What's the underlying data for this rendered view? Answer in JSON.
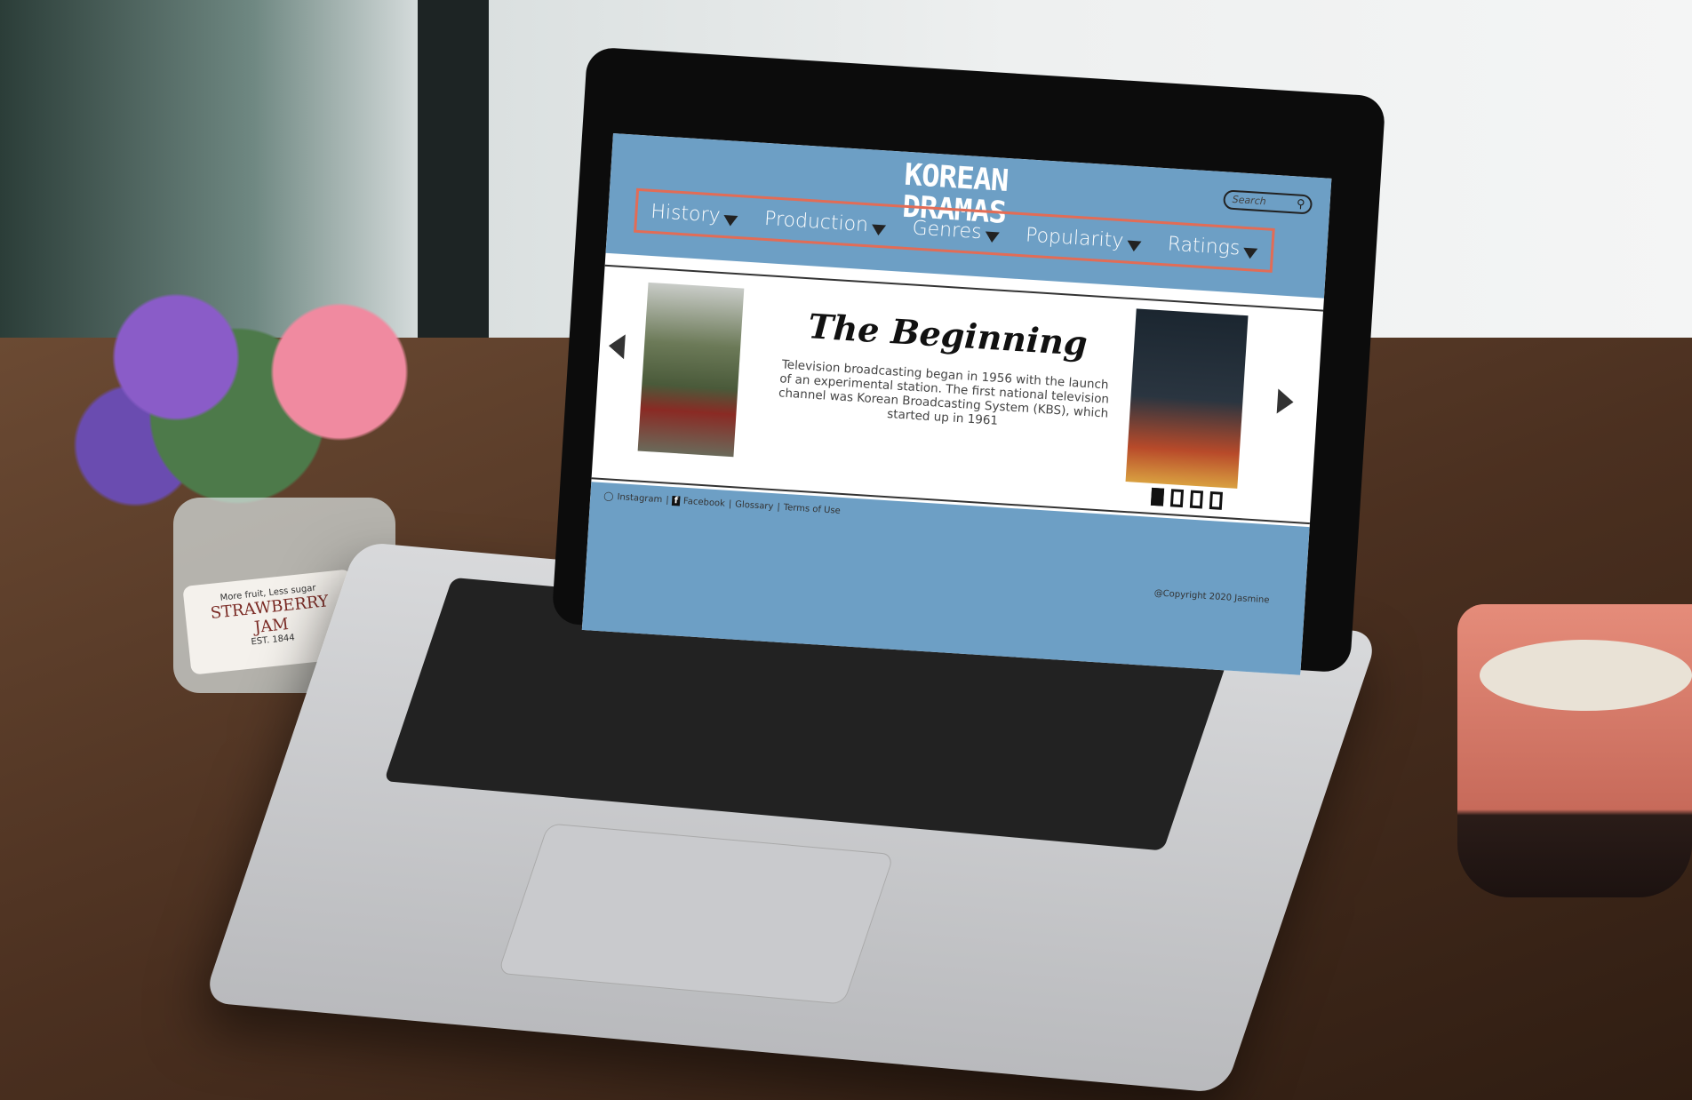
{
  "site": {
    "logo_line1": "KOREAN",
    "logo_line2": "DRAMAS",
    "search_placeholder": "Search",
    "nav": [
      {
        "label": "History"
      },
      {
        "label": "Production"
      },
      {
        "label": "Genres"
      },
      {
        "label": "Popularity"
      },
      {
        "label": "Ratings"
      }
    ],
    "hero": {
      "title": "The Beginning",
      "body": "Television broadcasting began in 1956 with the launch of an experimental station. The first national television channel was Korean Broadcasting System (KBS), which started up in 1961",
      "slides_total": 4,
      "active_slide": 1
    },
    "footer": {
      "links": [
        {
          "label": "Instagram"
        },
        {
          "label": "Facebook"
        },
        {
          "label": "Glossary"
        },
        {
          "label": "Terms of Use"
        }
      ],
      "separator": "|",
      "copyright": "@Copyright 2020 Jasmine"
    },
    "colors": {
      "header": "#6d9fc5",
      "nav_outline": "#e26c56"
    }
  },
  "scene": {
    "jar_label_top": "More fruit, Less sugar",
    "jar_label_main": "STRAWBERRY",
    "jar_label_sub": "JAM",
    "jar_label_est": "EST. 1844"
  }
}
